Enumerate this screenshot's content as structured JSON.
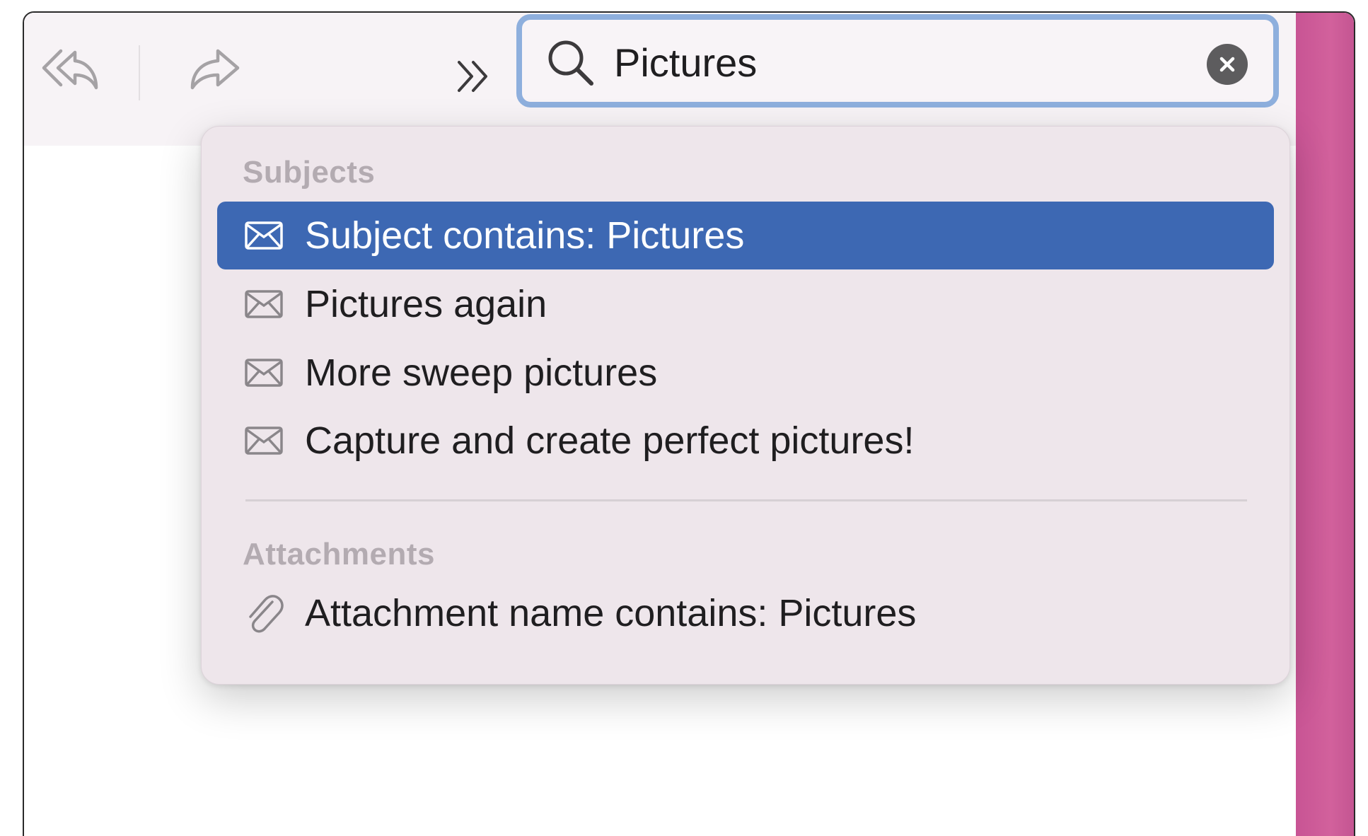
{
  "toolbar": {
    "reply_all_icon": "reply-all-icon",
    "forward_icon": "forward-icon",
    "overflow_icon": "chevron-double-right-icon"
  },
  "search": {
    "icon": "search-icon",
    "value": "Pictures",
    "clear_icon": "clear-icon"
  },
  "suggestions": {
    "subjects_header": "Subjects",
    "subject_items": [
      {
        "label": "Subject contains: Pictures",
        "icon": "envelope-icon",
        "selected": true
      },
      {
        "label": "Pictures again",
        "icon": "envelope-icon",
        "selected": false
      },
      {
        "label": "More sweep pictures",
        "icon": "envelope-icon",
        "selected": false
      },
      {
        "label": "Capture and create perfect pictures!",
        "icon": "envelope-icon",
        "selected": false
      }
    ],
    "attachments_header": "Attachments",
    "attachment_items": [
      {
        "label": "Attachment name contains: Pictures",
        "icon": "paperclip-icon",
        "selected": false
      }
    ]
  },
  "colors": {
    "selection": "#3d68b3",
    "search_focus_ring": "#8eafdd",
    "side_panel": "#d2619c",
    "dropdown_bg": "#eee6eb"
  }
}
